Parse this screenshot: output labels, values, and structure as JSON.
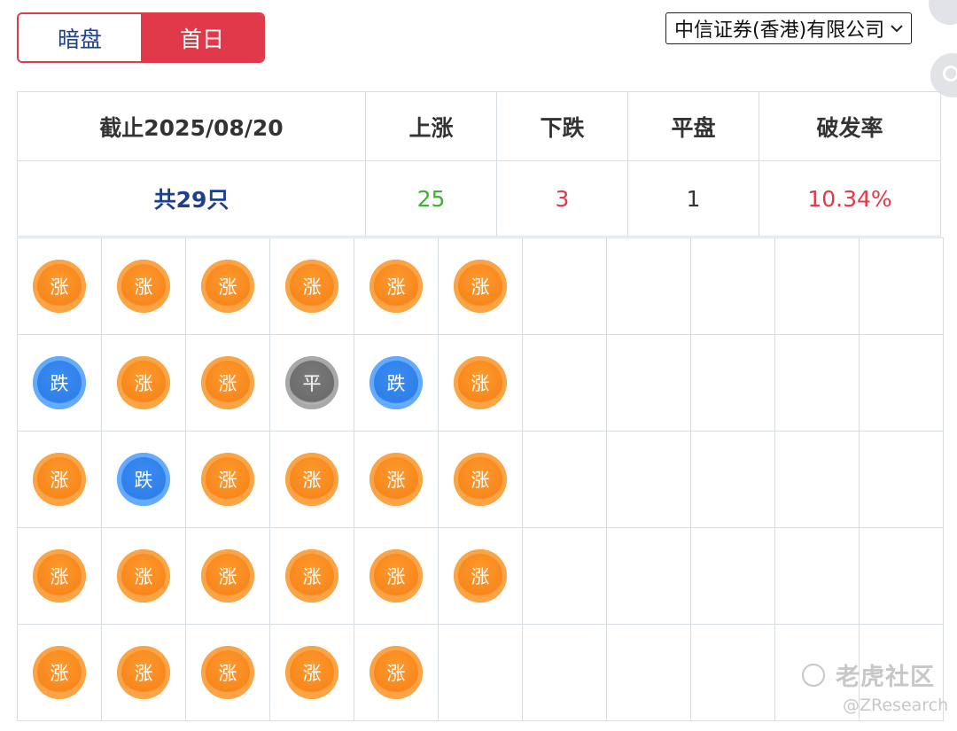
{
  "tabs": [
    {
      "label": "暗盘",
      "active": false
    },
    {
      "label": "首日",
      "active": true
    }
  ],
  "broker_select": {
    "value": "中信证券(香港)有限公司"
  },
  "summary": {
    "headers": {
      "date": "截止2025/08/20",
      "up": "上涨",
      "down": "下跌",
      "flat": "平盘",
      "rate": "破发率"
    },
    "values": {
      "total": "共29只",
      "up": "25",
      "down": "3",
      "flat": "1",
      "rate": "10.34%"
    }
  },
  "coin_labels": {
    "up": "涨",
    "down": "跌",
    "flat": "平"
  },
  "coin_grid": [
    [
      "up",
      "up",
      "up",
      "up",
      "up",
      "up"
    ],
    [
      "down",
      "up",
      "up",
      "flat",
      "down",
      "up"
    ],
    [
      "up",
      "down",
      "up",
      "up",
      "up",
      "up"
    ],
    [
      "up",
      "up",
      "up",
      "up",
      "up",
      "up"
    ],
    [
      "up",
      "up",
      "up",
      "up",
      "up"
    ]
  ],
  "colors": {
    "accent": "#e0394a",
    "up_text": "#38b62e",
    "down_text": "#e0394a",
    "navy": "#1e3f8a",
    "coin_up": "#f7871c",
    "coin_down": "#2f7fea",
    "coin_flat": "#6c6c6c"
  },
  "watermark": {
    "brand": "老虎社区",
    "handle": "@ZResearch"
  }
}
